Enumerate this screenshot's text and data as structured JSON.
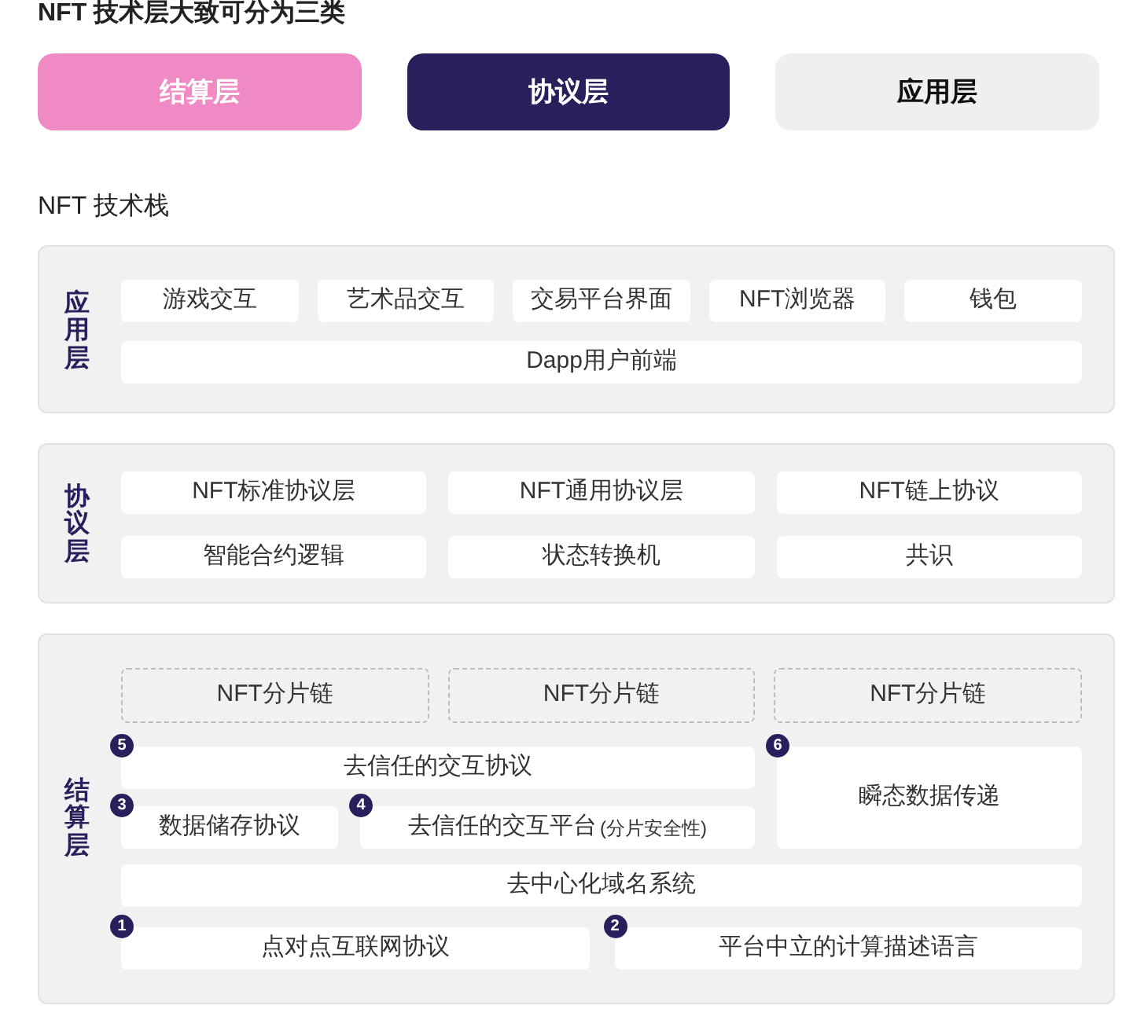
{
  "title": "NFT 技术层大致可分为三类",
  "categories": [
    {
      "label": "结算层",
      "color": "#ef8ac4"
    },
    {
      "label": "协议层",
      "color": "#2a1f5c"
    },
    {
      "label": "应用层",
      "color": "#efefef"
    }
  ],
  "stack_title": "NFT 技术栈",
  "application_layer": {
    "label": "应用层",
    "apps": [
      "游戏交互",
      "艺术品交互",
      "交易平台界面",
      "NFT浏览器",
      "钱包"
    ],
    "frontend": "Dapp用户前端"
  },
  "protocol_layer": {
    "label": "协议层",
    "rows": [
      [
        "NFT标准协议层",
        "NFT通用协议层",
        "NFT链上协议"
      ],
      [
        "智能合约逻辑",
        "状态转换机",
        "共识"
      ]
    ]
  },
  "settlement_layer": {
    "label": "结算层",
    "shard_chains": [
      "NFT分片链",
      "NFT分片链",
      "NFT分片链"
    ],
    "trustless_protocol": {
      "text": "去信任的交互协议",
      "badge": "5"
    },
    "data_storage": {
      "text": "数据储存协议",
      "badge": "3"
    },
    "trustless_platform": {
      "text": "去信任的交互平台",
      "note": "(分片安全性)",
      "badge": "4"
    },
    "transient_data": {
      "text": "瞬态数据传递",
      "badge": "6"
    },
    "domain_system": {
      "text": "去中心化域名系统"
    },
    "p2p": {
      "text": "点对点互联网协议",
      "badge": "1"
    },
    "computation_language": {
      "text": "平台中立的计算描述语言",
      "badge": "2"
    }
  }
}
